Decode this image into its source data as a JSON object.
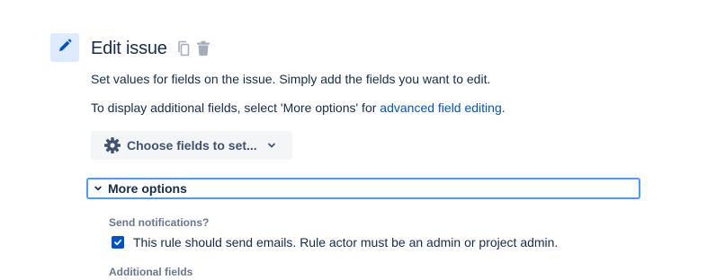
{
  "action": {
    "title": "Edit issue",
    "icon": "pencil-icon",
    "actions": [
      "copy-icon",
      "trash-icon"
    ]
  },
  "description": {
    "line1": "Set values for fields on the issue. Simply add the fields you want to edit.",
    "line2_prefix": "To display additional fields, select 'More options' for ",
    "line2_link": "advanced field editing",
    "line2_suffix": "."
  },
  "choose_fields": {
    "label": "Choose fields to set...",
    "icon": "gear-icon"
  },
  "more_options": {
    "label": "More options",
    "expanded": true
  },
  "notifications": {
    "label": "Send notifications?",
    "checkbox_label": "This rule should send emails. Rule actor must be an admin or project admin.",
    "checked": true
  },
  "additional_fields": {
    "label": "Additional fields"
  },
  "colors": {
    "accent": "#0052cc",
    "icon_bg": "#deebff",
    "focus_border": "#4c9aff",
    "button_bg": "#f4f5f7"
  }
}
